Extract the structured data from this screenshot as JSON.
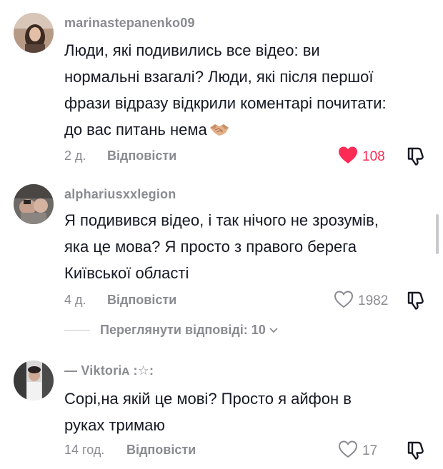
{
  "comments": [
    {
      "username": "marinastepanenko09",
      "lines": [
        "Люди, які подивились все відео: ви",
        "нормальні взагалі? Люди, які після першої",
        "фрази відразу відкрили коментарі почитати:",
        "до вас питань нема"
      ],
      "emoji": "handshake",
      "time": "2 д.",
      "reply_label": "Відповісти",
      "likes": "108",
      "liked": true
    },
    {
      "username": "alphariusxxlegion",
      "lines": [
        "Я подивився відео, і так нічого не зрозумів,",
        "яка це мова? Я просто з правого берега",
        "Київської області"
      ],
      "time": "4 д.",
      "reply_label": "Відповісти",
      "likes": "1982",
      "liked": false,
      "view_replies": "Переглянути відповіді: 10"
    },
    {
      "username": "— Viktoriᴀ :☆:",
      "lines": [
        "Сорі,на якій це мові? Просто я айфон в",
        "руках тримаю"
      ],
      "time": "14 год.",
      "reply_label": "Відповісти",
      "likes": "17",
      "liked": false
    }
  ],
  "colors": {
    "text": "#161823",
    "secondary": "#8a8b91",
    "like_active": "#fe2c55"
  },
  "icons": [
    "heart-icon",
    "heart-outline-icon",
    "dislike-icon",
    "chevron-down-icon",
    "handshake-emoji"
  ]
}
